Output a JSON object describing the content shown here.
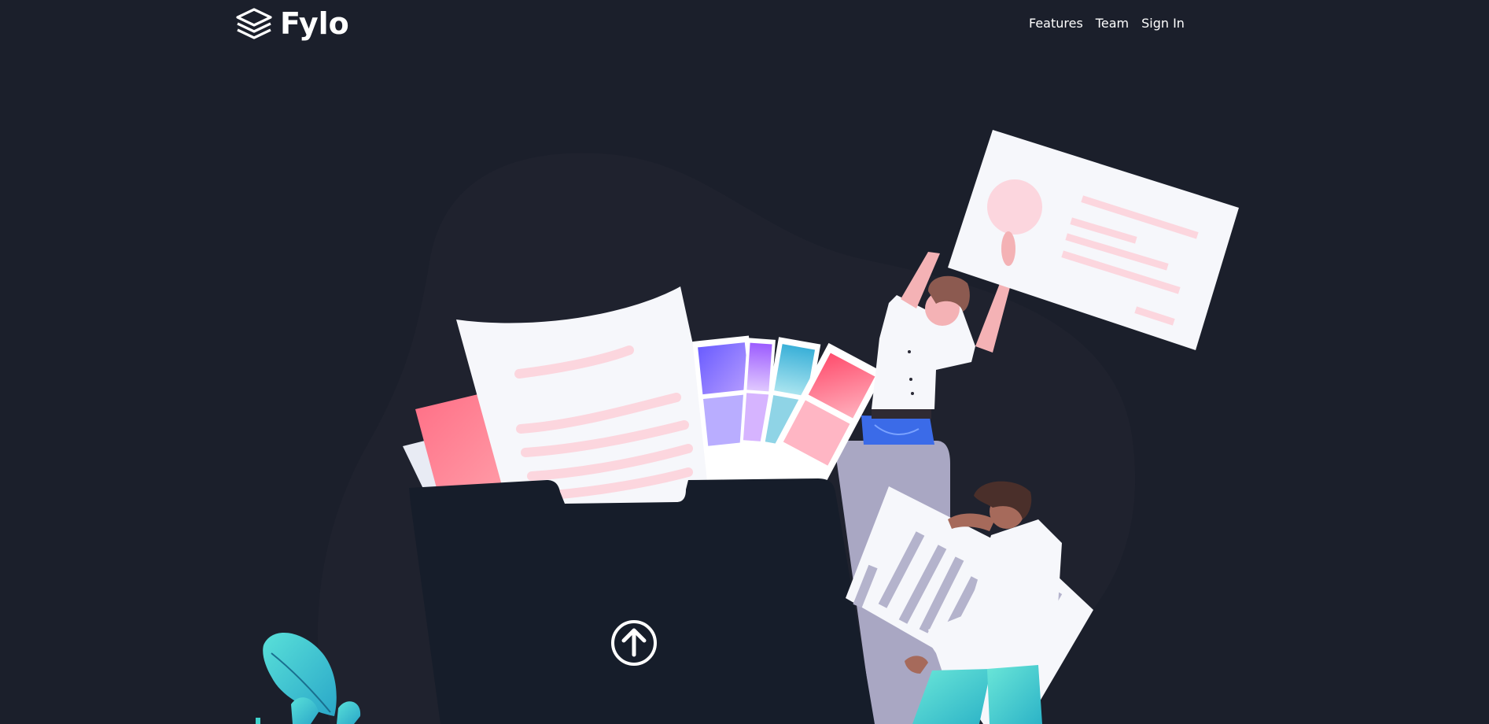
{
  "header": {
    "logo": {
      "icon": "stack-layers-icon",
      "text": "Fylo"
    },
    "nav": [
      {
        "label": "Features"
      },
      {
        "label": "Team"
      },
      {
        "label": "Sign In"
      }
    ]
  },
  "hero": {
    "illustration": "people-uploading-files-to-folder-illustration",
    "upload_icon": "arrow-up-circle-icon"
  },
  "colors": {
    "background": "#1b1f2b",
    "blob": "#1f222e",
    "folder": "#161d2a",
    "text": "#ffffff",
    "accent_pink": "#ff7b8f",
    "accent_teal": "#3fd2cb"
  }
}
